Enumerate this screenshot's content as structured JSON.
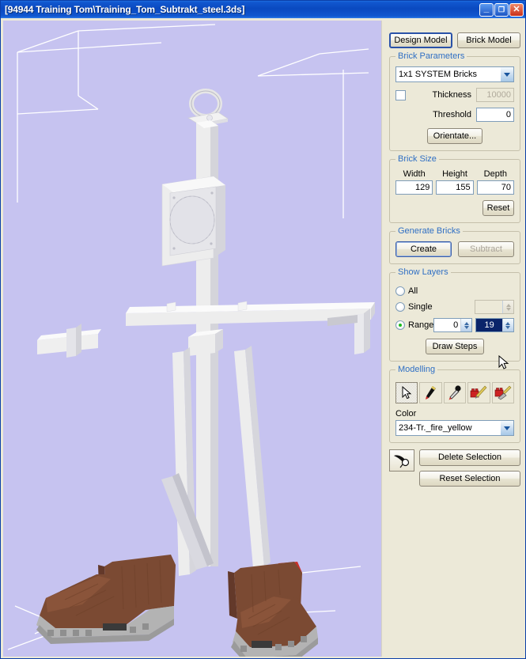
{
  "window": {
    "title": "[94944 Training Tom\\Training_Tom_Subtrakt_steel.3ds]",
    "minimize_label": "–",
    "maximize_label": "❐",
    "close_label": "✕",
    "titlebar_color": "#0a49c0",
    "panel_color": "#ece9d8",
    "viewport_color": "#c6c3f0"
  },
  "mode_buttons": {
    "design_model": "Design Model",
    "brick_model": "Brick Model"
  },
  "brick_parameters": {
    "title": "Brick Parameters",
    "brick_type_value": "1x1 SYSTEM Bricks",
    "thickness_label": "Thickness",
    "thickness_value": "10000",
    "thickness_enabled": false,
    "threshold_label": "Threshold",
    "threshold_value": "0",
    "orientate_label": "Orientate..."
  },
  "brick_size": {
    "title": "Brick Size",
    "headers": [
      "Width",
      "Height",
      "Depth"
    ],
    "values": [
      "129",
      "155",
      "70"
    ],
    "reset_label": "Reset"
  },
  "generate_bricks": {
    "title": "Generate Bricks",
    "create_label": "Create",
    "subtract_label": "Subtract",
    "subtract_enabled": false
  },
  "show_layers": {
    "title": "Show Layers",
    "all_label": "All",
    "single_label": "Single",
    "range_label": "Range",
    "selected_option": "Range",
    "single_value": "",
    "range_from": "0",
    "range_to": "19",
    "draw_steps_label": "Draw Steps"
  },
  "modelling": {
    "title": "Modelling",
    "tools": [
      {
        "name": "select-arrow-tool",
        "active": true
      },
      {
        "name": "pencil-tool",
        "active": false
      },
      {
        "name": "eyedropper-tool",
        "active": false
      },
      {
        "name": "brick-pencil-tool",
        "active": false
      },
      {
        "name": "brick-trowel-tool",
        "active": false
      }
    ],
    "color_label": "Color",
    "color_value": "234-Tr._fire_yellow"
  },
  "selection": {
    "pick_tool_name": "selection-pick-tool",
    "delete_label": "Delete Selection",
    "reset_label": "Reset Selection"
  },
  "viewport": {
    "model_name": "lego-boots-mannequin-model",
    "colors": {
      "background": "#c6c3f0",
      "mannequin": "#efefef",
      "mannequin_shade": "#d2d2d8",
      "boot_brown": "#7b4a33",
      "boot_brown_dark": "#63392a",
      "sole_grey": "#b3b3b3",
      "sock_yellow": "#e8d037",
      "accent_red": "#c8302a",
      "grid_line": "#ffffff"
    }
  }
}
